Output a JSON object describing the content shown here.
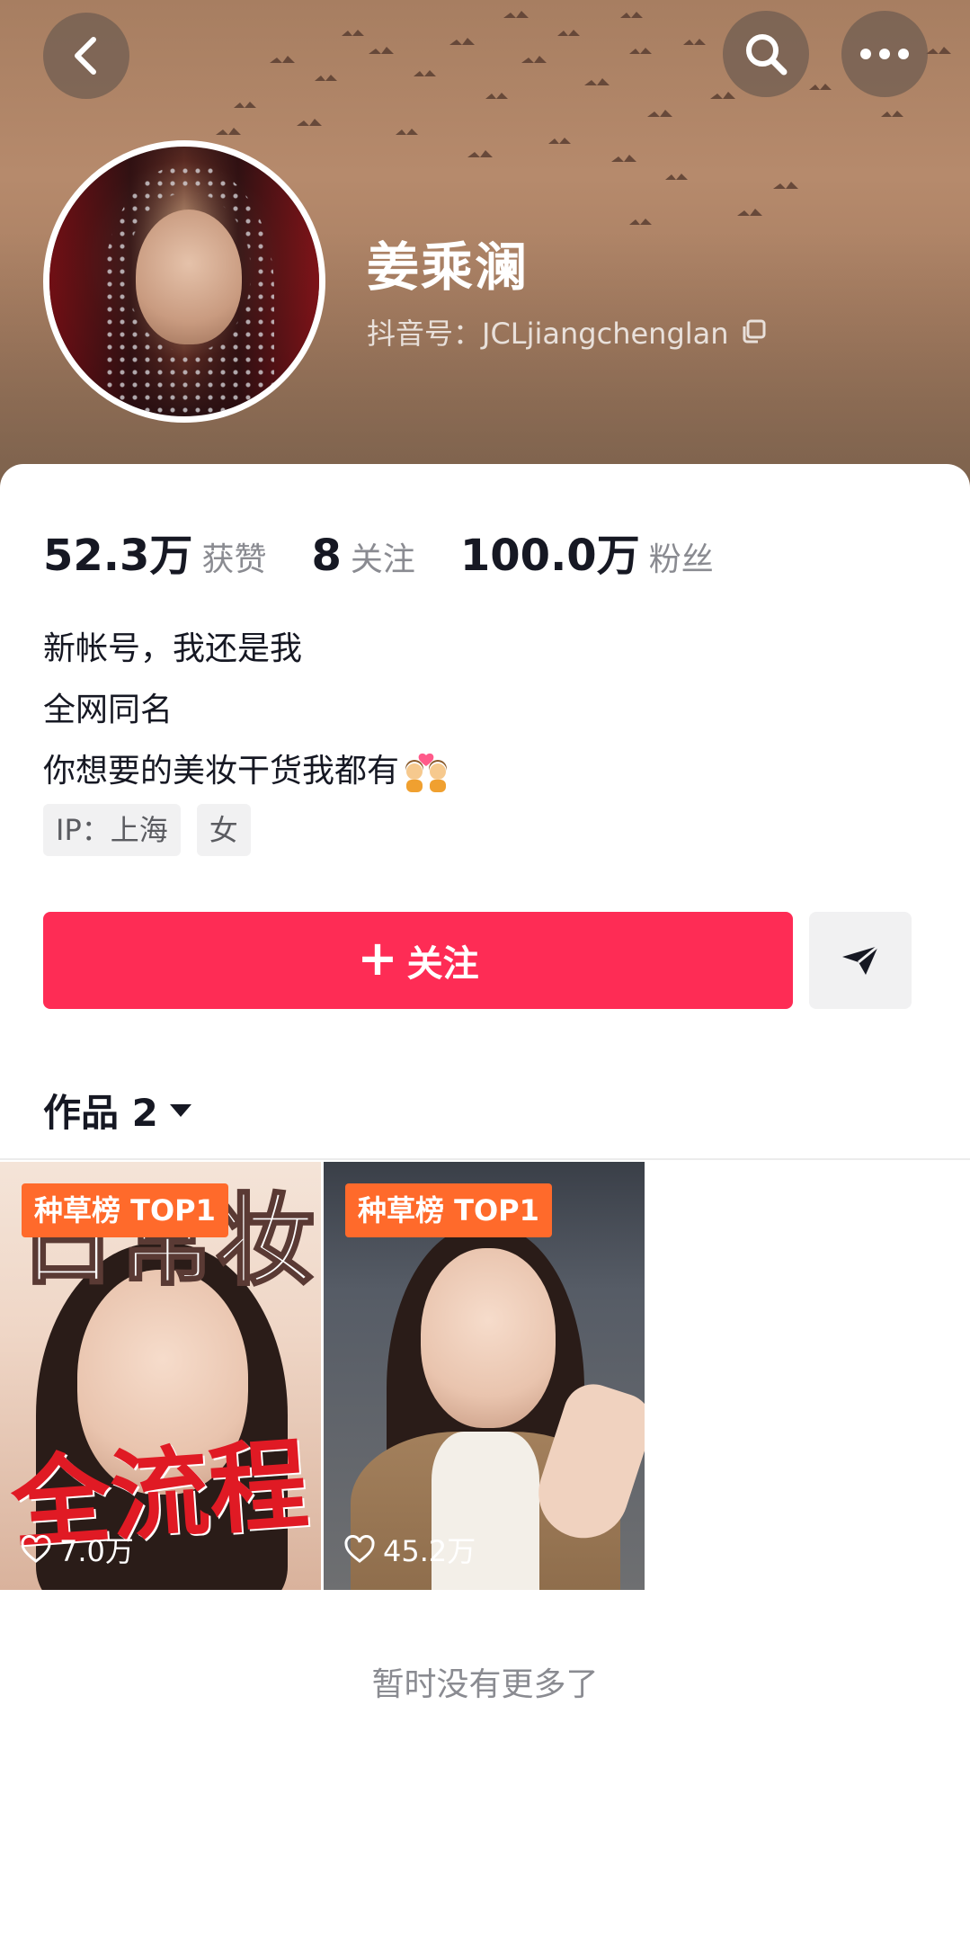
{
  "profile": {
    "name": "姜乘澜",
    "handle": "抖音号：JCLjiangchenglan"
  },
  "stats": [
    {
      "value": "52.3万",
      "label": "获赞"
    },
    {
      "value": "8",
      "label": "关注"
    },
    {
      "value": "100.0万",
      "label": "粉丝"
    }
  ],
  "bio": {
    "line1": "新帐号，我还是我",
    "line2": "全网同名",
    "line3": "你想要的美妆干货我都有"
  },
  "tags": {
    "ip": "IP：上海",
    "gender": "女"
  },
  "actions": {
    "follow_plus": "+",
    "follow_label": "关注"
  },
  "works": {
    "label": "作品 2",
    "items": [
      {
        "badge": "种草榜 TOP1",
        "likes": "7.0万",
        "title_top": "日常妆",
        "title_red": "全流程"
      },
      {
        "badge": "种草榜 TOP1",
        "likes": "45.2万"
      }
    ]
  },
  "footer": {
    "no_more": "暂时没有更多了"
  },
  "icons": {
    "back": "chevron-left-icon",
    "search": "search-icon",
    "more": "more-horizontal-icon",
    "copy": "copy-icon",
    "share": "send-icon",
    "dropdown": "caret-down-icon",
    "like": "heart-outline-icon"
  },
  "colors": {
    "accent": "#fe2c55",
    "badge": "#ff6a2b"
  }
}
